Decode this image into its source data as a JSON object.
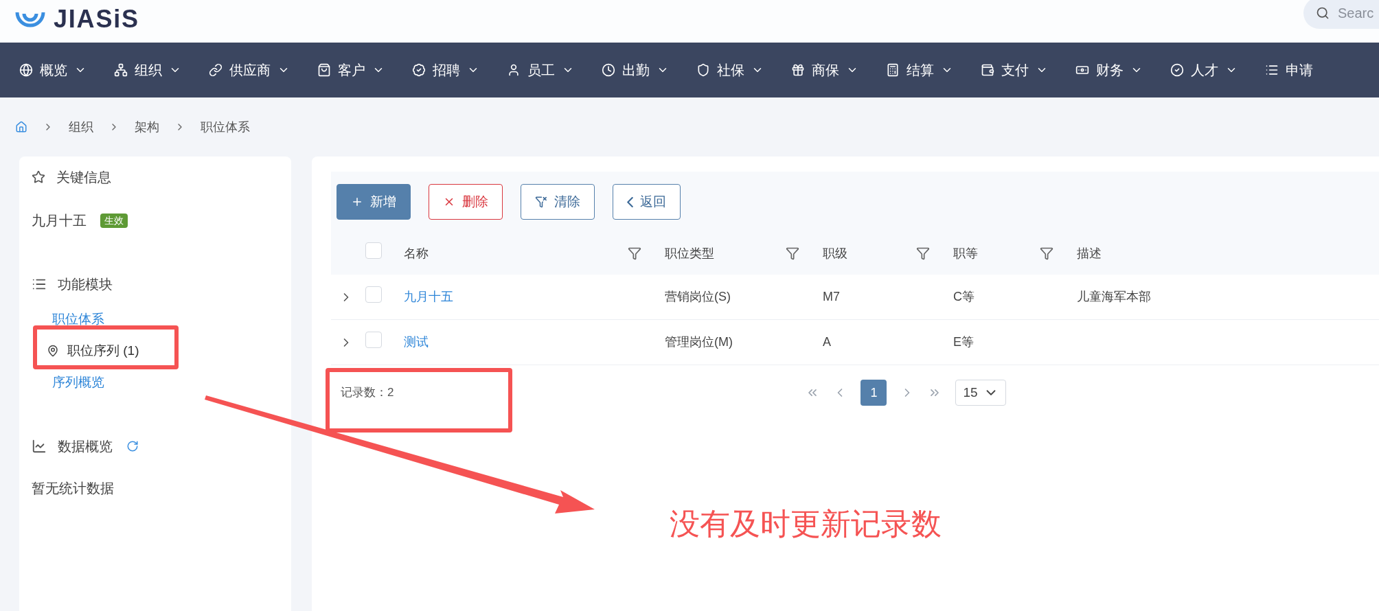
{
  "header": {
    "logo": "JIASiS",
    "search": {
      "placeholder": "Searc"
    }
  },
  "nav": [
    {
      "label": "概览"
    },
    {
      "label": "组织"
    },
    {
      "label": "供应商"
    },
    {
      "label": "客户"
    },
    {
      "label": "招聘"
    },
    {
      "label": "员工"
    },
    {
      "label": "出勤"
    },
    {
      "label": "社保"
    },
    {
      "label": "商保"
    },
    {
      "label": "结算"
    },
    {
      "label": "支付"
    },
    {
      "label": "财务"
    },
    {
      "label": "人才"
    },
    {
      "label": "申请"
    }
  ],
  "breadcrumb": [
    "组织",
    "架构",
    "职位体系"
  ],
  "sidebar": {
    "key_info": {
      "title": "关键信息",
      "name": "九月十五",
      "badge": {
        "label": "生效",
        "color": "#5e9a35"
      }
    },
    "modules": {
      "title": "功能模块",
      "items": [
        {
          "label": "职位体系",
          "selected": false
        },
        {
          "label": "职位序列 (1)",
          "selected": true
        },
        {
          "label": "序列概览",
          "selected": false
        }
      ]
    },
    "stats": {
      "title": "数据概览",
      "empty": "暂无统计数据"
    }
  },
  "toolbar": [
    {
      "kind": "primary",
      "label": "新增"
    },
    {
      "kind": "danger",
      "label": "删除"
    },
    {
      "kind": "filter",
      "label": "清除"
    },
    {
      "kind": "back",
      "label": "返回"
    }
  ],
  "table": {
    "header_checked": false,
    "columns": [
      "名称",
      "职位类型",
      "职级",
      "职等",
      "描述"
    ],
    "rows": [
      {
        "expanded": false,
        "checked": false,
        "cells": [
          "九月十五",
          "营销岗位(S)",
          "M7",
          "C等",
          "儿童海军本部"
        ]
      },
      {
        "expanded": false,
        "checked": false,
        "cells": [
          "测试",
          "管理岗位(M)",
          "A",
          "E等",
          ""
        ]
      }
    ]
  },
  "footer": {
    "record_count": "记录数：2",
    "pages": [
      {
        "label": "1",
        "selected": true
      }
    ],
    "page_size": "15"
  },
  "annotation": {
    "note": "没有及时更新记录数"
  }
}
